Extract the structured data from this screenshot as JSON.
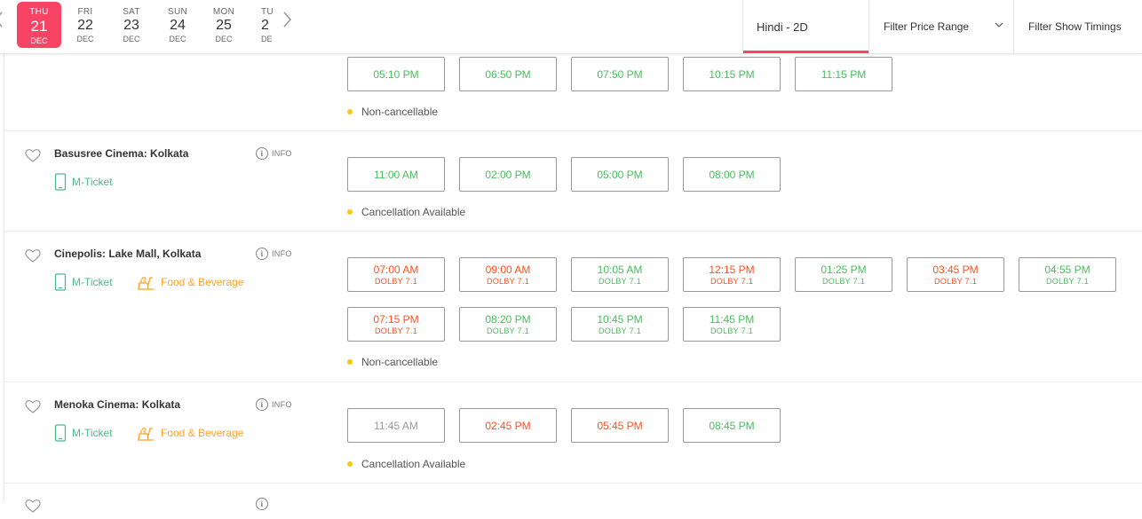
{
  "dates": [
    {
      "dow": "THU",
      "day": "21",
      "mon": "DEC",
      "active": true
    },
    {
      "dow": "FRI",
      "day": "22",
      "mon": "DEC",
      "active": false
    },
    {
      "dow": "SAT",
      "day": "23",
      "mon": "DEC",
      "active": false
    },
    {
      "dow": "SUN",
      "day": "24",
      "mon": "DEC",
      "active": false
    },
    {
      "dow": "MON",
      "day": "25",
      "mon": "DEC",
      "active": false
    },
    {
      "dow": "TU",
      "day": "2",
      "mon": "DE",
      "active": false
    }
  ],
  "filters": {
    "language": "Hindi - 2D",
    "price": "Filter Price Range",
    "timings": "Filter Show Timings"
  },
  "labels": {
    "info": "INFO",
    "mticket": "M-Ticket",
    "food": "Food & Beverage"
  },
  "colors": {
    "accent": "#f84464",
    "available": "#4abd5d",
    "filling_fast": "#ff5023",
    "sold_out": "#999999",
    "mticket": "#49ba8e",
    "food": "#ffa426",
    "dot": "#ffc610"
  },
  "venues": [
    {
      "name": "",
      "cancellation": "Non-cancellable",
      "shows": [
        {
          "time": "05:10 PM",
          "status": "green"
        },
        {
          "time": "06:50 PM",
          "status": "green"
        },
        {
          "time": "07:50 PM",
          "status": "green"
        },
        {
          "time": "10:15 PM",
          "status": "green"
        },
        {
          "time": "11:15 PM",
          "status": "green"
        }
      ]
    },
    {
      "name": "Basusree Cinema: Kolkata",
      "cancellation": "Cancellation Available",
      "shows": [
        {
          "time": "11:00 AM",
          "status": "green"
        },
        {
          "time": "02:00 PM",
          "status": "green"
        },
        {
          "time": "05:00 PM",
          "status": "green"
        },
        {
          "time": "08:00 PM",
          "status": "green"
        }
      ]
    },
    {
      "name": "Cinepolis: Lake Mall, Kolkata",
      "cancellation": "Non-cancellable",
      "shows": [
        {
          "time": "07:00 AM",
          "format": "DOLBY 7.1",
          "status": "orange"
        },
        {
          "time": "09:00 AM",
          "format": "DOLBY 7.1",
          "status": "orange"
        },
        {
          "time": "10:05 AM",
          "format": "DOLBY 7.1",
          "status": "green"
        },
        {
          "time": "12:15 PM",
          "format": "DOLBY 7.1",
          "status": "orange"
        },
        {
          "time": "01:25 PM",
          "format": "DOLBY 7.1",
          "status": "green"
        },
        {
          "time": "03:45 PM",
          "format": "DOLBY 7.1",
          "status": "orange"
        },
        {
          "time": "04:55 PM",
          "format": "DOLBY 7.1",
          "status": "green"
        },
        {
          "time": "07:15 PM",
          "format": "DOLBY 7.1",
          "status": "orange"
        },
        {
          "time": "08:20 PM",
          "format": "DOLBY 7.1",
          "status": "green"
        },
        {
          "time": "10:45 PM",
          "format": "DOLBY 7.1",
          "status": "green"
        },
        {
          "time": "11:45 PM",
          "format": "DOLBY 7.1",
          "status": "green"
        }
      ]
    },
    {
      "name": "Menoka Cinema: Kolkata",
      "cancellation": "Cancellation Available",
      "shows": [
        {
          "time": "11:45 AM",
          "status": "grey"
        },
        {
          "time": "02:45 PM",
          "status": "orange"
        },
        {
          "time": "05:45 PM",
          "status": "orange"
        },
        {
          "time": "08:45 PM",
          "status": "green"
        }
      ]
    }
  ]
}
